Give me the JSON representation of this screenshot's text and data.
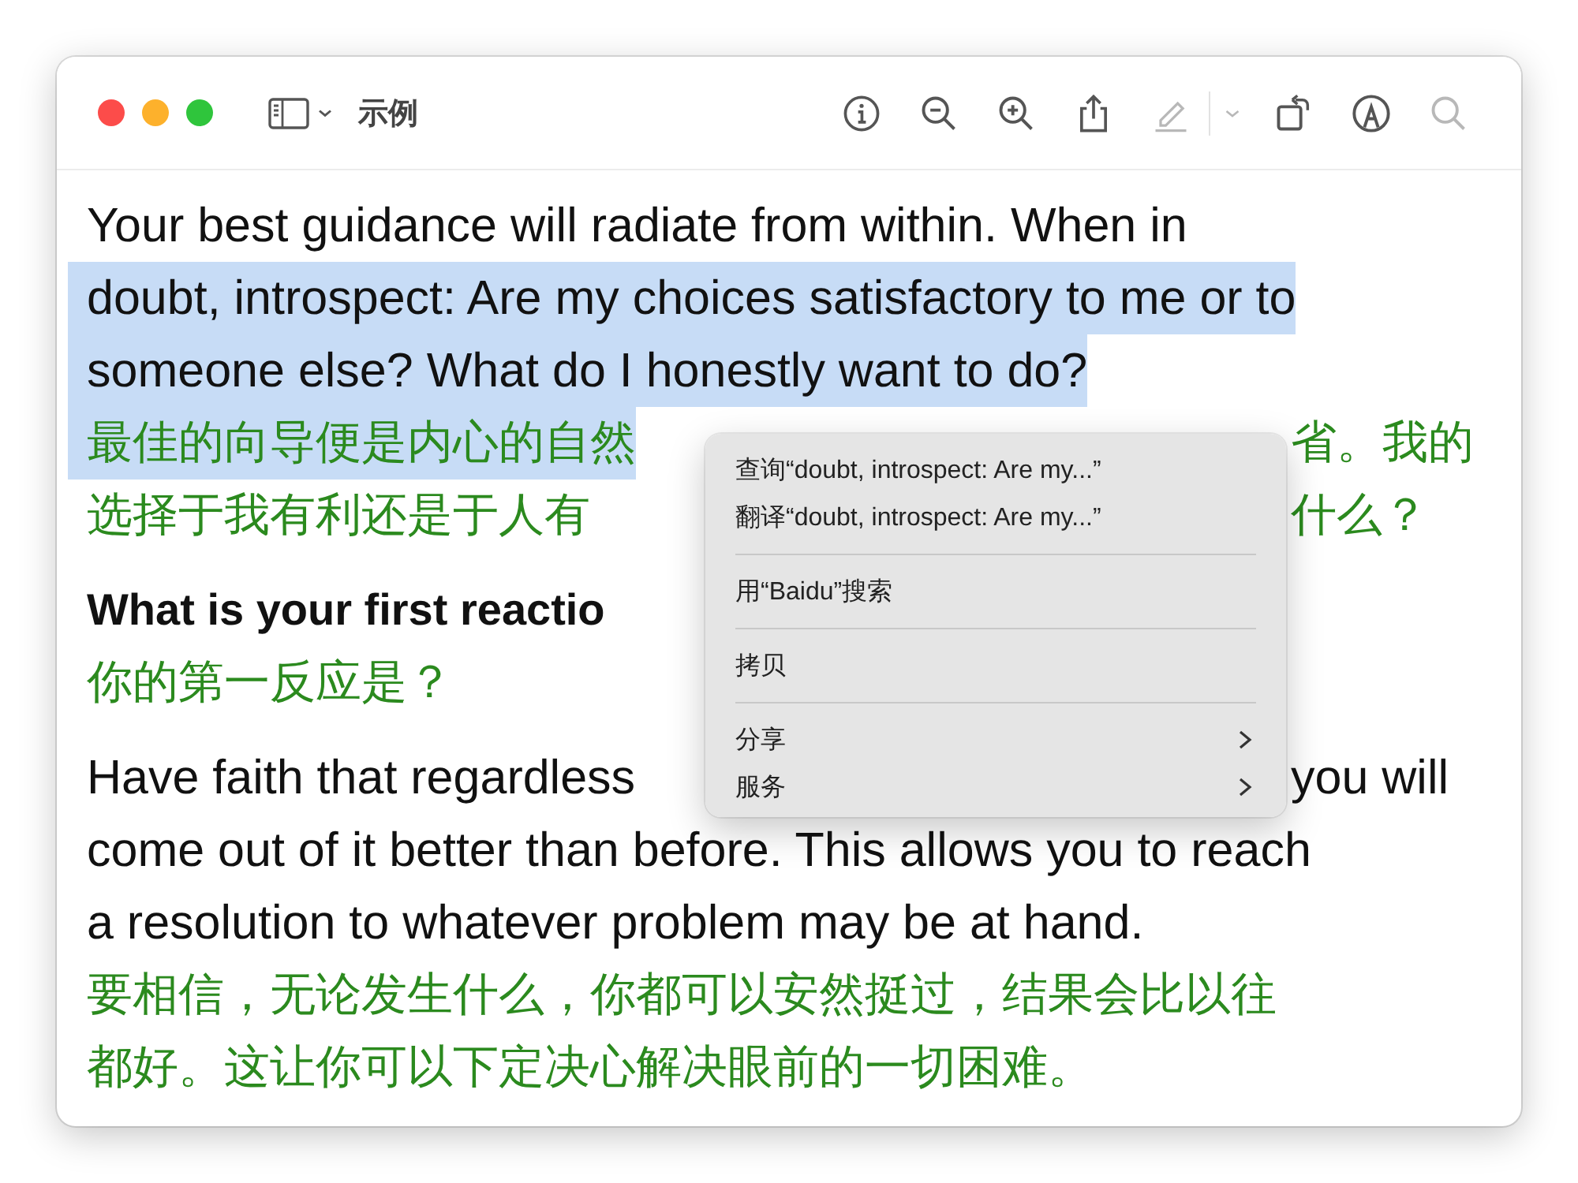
{
  "window": {
    "title": "示例"
  },
  "toolbar": {
    "tools": [
      {
        "kind": "info",
        "disabled": false
      },
      {
        "kind": "zoom-out",
        "disabled": false
      },
      {
        "kind": "zoom-in",
        "disabled": false
      },
      {
        "kind": "share",
        "disabled": false
      },
      {
        "kind": "pencil",
        "disabled": true
      },
      {
        "kind": "divider",
        "disabled": true
      },
      {
        "kind": "chevron",
        "disabled": true
      },
      {
        "kind": "rotate",
        "disabled": false
      },
      {
        "kind": "markup",
        "disabled": false
      },
      {
        "kind": "search",
        "disabled": true
      }
    ]
  },
  "document": {
    "paragraphs": [
      {
        "lines": [
          {
            "kind": "english",
            "left": "Your best guidance will radiate from within. When in",
            "selected": false
          },
          {
            "kind": "english",
            "left": "doubt, introspect: Are my choices satisfactory to me or to",
            "selected": true
          },
          {
            "kind": "english",
            "left": "someone else? What do I honestly want to do?",
            "selected": true
          },
          {
            "kind": "chinese",
            "left": "最佳的向导便是内心的自然",
            "right": "省。我的",
            "selected": true
          },
          {
            "kind": "chinese",
            "left": "选择于我有利还是于人有",
            "right": "什么？",
            "selected": false
          }
        ]
      },
      {
        "lines": [
          {
            "kind": "heading",
            "left": "What is your first reactio",
            "selected": false
          },
          {
            "kind": "chinese",
            "left": "你的第一反应是？",
            "selected": false
          }
        ]
      },
      {
        "lines": [
          {
            "kind": "english",
            "left": "Have faith that regardless",
            "right": "you will",
            "selected": false
          },
          {
            "kind": "english",
            "left": "come out of it better than before. This allows you to reach",
            "selected": false
          },
          {
            "kind": "english",
            "left": "a resolution to whatever problem may be at hand.",
            "selected": false
          },
          {
            "kind": "chinese",
            "left": "要相信，无论发生什么，你都可以安然挺过，结果会比以往",
            "selected": false
          },
          {
            "kind": "chinese",
            "left": "都好。这让你可以下定决心解决眼前的一切困难。",
            "selected": false
          }
        ]
      }
    ]
  },
  "context_menu": {
    "items": [
      {
        "kind": "item",
        "label": "查询“doubt, introspect: Are my...”"
      },
      {
        "kind": "item",
        "label": "翻译“doubt, introspect: Are my...”"
      },
      {
        "kind": "separator"
      },
      {
        "kind": "item",
        "label": "用“Baidu”搜索"
      },
      {
        "kind": "separator"
      },
      {
        "kind": "item",
        "label": "拷贝"
      },
      {
        "kind": "separator"
      },
      {
        "kind": "submenu",
        "label": "分享"
      },
      {
        "kind": "submenu",
        "label": "服务"
      }
    ]
  }
}
